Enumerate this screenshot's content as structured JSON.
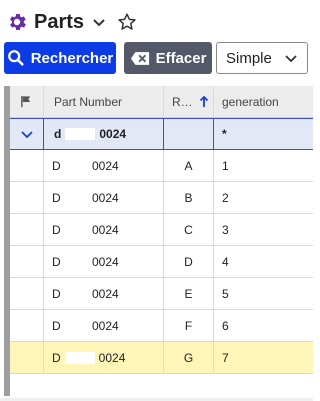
{
  "header": {
    "title": "Parts",
    "gear_icon": "gear-icon",
    "chevron_icon": "chevron-down-icon",
    "star_icon": "star-outline-icon"
  },
  "toolbar": {
    "search_label": "Rechercher",
    "clear_label": "Effacer",
    "mode_value": "Simple"
  },
  "grid": {
    "columns": [
      "Part Number",
      "R…",
      "generation"
    ],
    "filter_row": {
      "part_prefix": "d",
      "part_suffix": "0024",
      "rev": "",
      "generation": "*"
    },
    "rows": [
      {
        "part_prefix": "D",
        "part_suffix": "0024",
        "rev": "A",
        "generation": "1"
      },
      {
        "part_prefix": "D",
        "part_suffix": "0024",
        "rev": "B",
        "generation": "2"
      },
      {
        "part_prefix": "D",
        "part_suffix": "0024",
        "rev": "C",
        "generation": "3"
      },
      {
        "part_prefix": "D",
        "part_suffix": "0024",
        "rev": "D",
        "generation": "4"
      },
      {
        "part_prefix": "D",
        "part_suffix": "0024",
        "rev": "E",
        "generation": "5"
      },
      {
        "part_prefix": "D",
        "part_suffix": "0024",
        "rev": "F",
        "generation": "6"
      },
      {
        "part_prefix": "D",
        "part_suffix": "0024",
        "rev": "G",
        "generation": "7"
      }
    ]
  },
  "colors": {
    "primary": "#0d3ce6",
    "secondary": "#54596a",
    "accent_purple": "#6a2aa8",
    "selection": "#fff5b8",
    "filter_bg": "#e3e8f6"
  }
}
